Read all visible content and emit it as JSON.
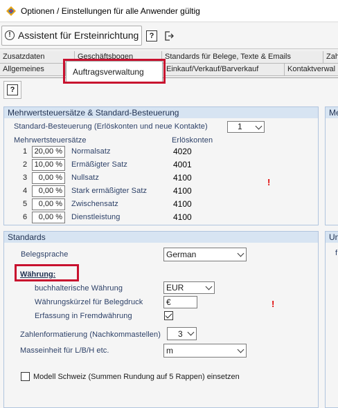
{
  "window": {
    "title": "Optionen / Einstellungen für alle Anwender gültig"
  },
  "toolbar": {
    "assistant_label": "Assistent für Ersteinrichtung",
    "help_label": "?"
  },
  "tabs": {
    "row1": [
      "Zusatzdaten",
      "Geschäftsbogen",
      "Standards für Belege, Texte & Emails",
      "Zah"
    ],
    "row2": [
      "Allgemeines",
      "Auftragsverwaltung",
      "Einkauf/Verkauf/Barverkauf",
      "Kontaktverwal"
    ],
    "active": "Auftragsverwaltung"
  },
  "subtoolbar": {
    "help_label": "?"
  },
  "vat_panel": {
    "title": "Mehrwertsteuersätze & Standard-Besteuerung",
    "standard_taxation_label": "Standard-Besteuerung (Erlöskonten und neue Kontakte)",
    "standard_taxation_value": "1",
    "col_rates": "Mehrwertsteuersätze",
    "col_accounts": "Erlöskonten",
    "rows": [
      {
        "n": "1",
        "pct": "20,00 %",
        "name": "Normalsatz",
        "account": "4020"
      },
      {
        "n": "2",
        "pct": "10,00 %",
        "name": "Ermäßigter Satz",
        "account": "4001"
      },
      {
        "n": "3",
        "pct": "0,00 %",
        "name": "Nullsatz",
        "account": "4100"
      },
      {
        "n": "4",
        "pct": "0,00 %",
        "name": "Stark ermäßigter Satz",
        "account": "4100"
      },
      {
        "n": "5",
        "pct": "0,00 %",
        "name": "Zwischensatz",
        "account": "4100"
      },
      {
        "n": "6",
        "pct": "0,00 %",
        "name": "Dienstleistung",
        "account": "4100"
      }
    ],
    "warning": "!"
  },
  "right_panels": {
    "top_head": "Me",
    "bottom_head": "Un",
    "bottom_text": "f"
  },
  "standards_panel": {
    "title": "Standards",
    "belegsprache_label": "Belegsprache",
    "belegsprache_value": "German",
    "currency_heading": "Währung:",
    "accounting_currency_label": "buchhalterische Währung",
    "accounting_currency_value": "EUR",
    "currency_symbol_label": "Währungskürzel für Belegdruck",
    "currency_symbol_value": "€",
    "foreign_currency_label": "Erfassung in Fremdwährung",
    "foreign_currency_checked": true,
    "warning": "!",
    "number_format_label": "Zahlenformatierung (Nachkommastellen)",
    "number_format_value": "3",
    "unit_label": "Masseinheit für L/B/H etc.",
    "unit_value": "m",
    "swiss_model_label": "Modell Schweiz (Summen Rundung auf 5 Rappen) einsetzen",
    "swiss_model_checked": false
  },
  "colors": {
    "panel_header_bg": "#d7e4f2",
    "label_blue": "#2b3f66",
    "highlight_red": "#c8102e",
    "warning_red": "#e00000"
  }
}
